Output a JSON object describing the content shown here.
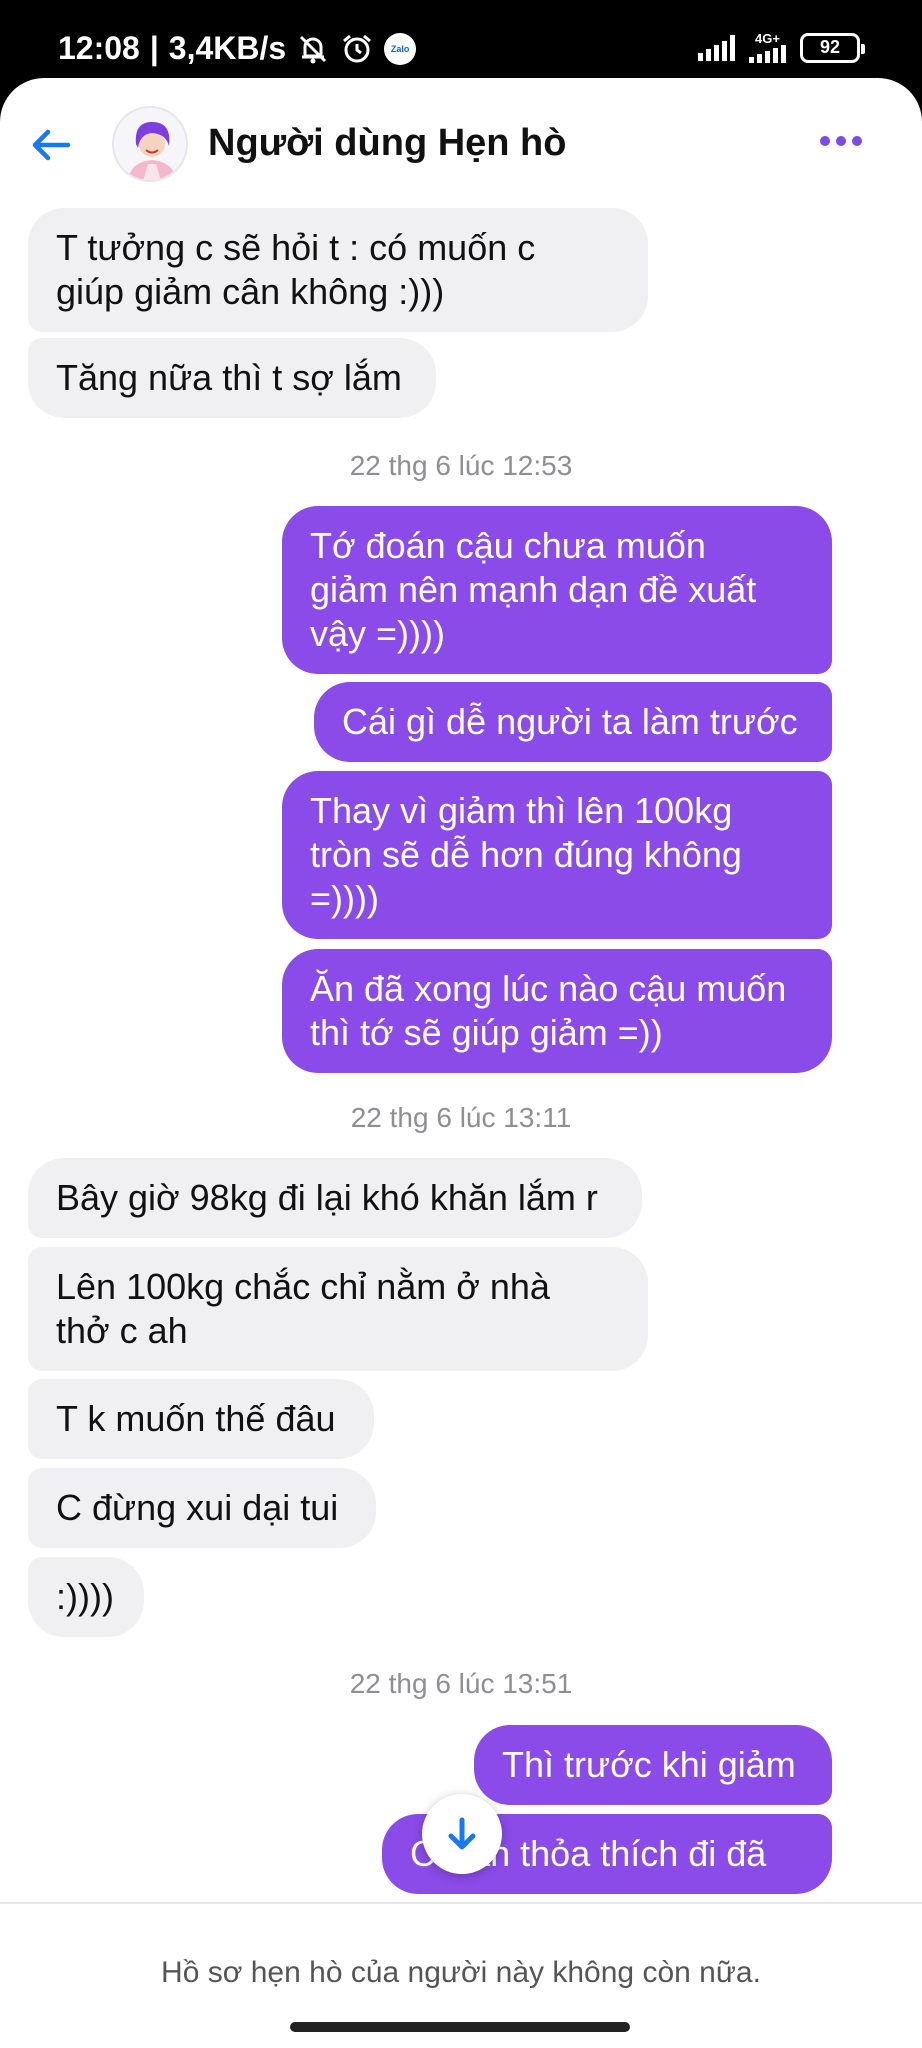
{
  "status_bar": {
    "time": "12:08",
    "speed": "3,4KB/s",
    "zalo_label": "Zalo",
    "network": "4G+",
    "battery": "92"
  },
  "header": {
    "title": "Người dùng Hẹn hò"
  },
  "messages": [
    {
      "side": "in",
      "text_lines": [
        "T tưởng c sẽ hỏi t : có muốn c",
        "giúp giảm cân không :)))"
      ]
    },
    {
      "side": "in",
      "text_lines": [
        "Tăng nữa thì t sợ lắm"
      ]
    },
    {
      "side": "out",
      "text_lines": [
        "Tớ đoán cậu chưa muốn",
        "giảm nên mạnh dạn đề xuất",
        "vậy =))))"
      ]
    },
    {
      "side": "out",
      "text_lines": [
        "Cái gì dễ người ta làm trước"
      ]
    },
    {
      "side": "out",
      "text_lines": [
        "Thay vì giảm thì lên 100kg",
        "tròn sẽ dễ hơn đúng không",
        "=))))"
      ]
    },
    {
      "side": "out",
      "text_lines": [
        "Ăn đã xong lúc nào cậu muốn",
        "thì tớ sẽ giúp giảm =))"
      ]
    },
    {
      "side": "in",
      "text_lines": [
        "Bây giờ 98kg đi lại khó khăn lắm r"
      ]
    },
    {
      "side": "in",
      "text_lines": [
        "Lên 100kg chắc chỉ nằm ở nhà",
        "thở c ah"
      ]
    },
    {
      "side": "in",
      "text_lines": [
        "T k muốn thế đâu"
      ]
    },
    {
      "side": "in",
      "text_lines": [
        "C đừng xui dại tui"
      ]
    },
    {
      "side": "in",
      "text_lines": [
        ":))))"
      ]
    },
    {
      "side": "out",
      "text_lines": [
        "Thì trước khi giảm"
      ]
    },
    {
      "side": "out",
      "text_lines": [
        "Cứ ăn thỏa thích đi đã"
      ]
    }
  ],
  "timestamps": [
    "22 thg 6 lúc 12:53",
    "22 thg 6 lúc 13:11",
    "22 thg 6 lúc 13:51"
  ],
  "footer": {
    "notice": "Hồ sơ hẹn hò của người này không còn nữa."
  },
  "colors": {
    "outgoing_bubble": "#8a4be8",
    "incoming_bubble": "#f0f0f3",
    "accent_blue": "#1877f2"
  }
}
